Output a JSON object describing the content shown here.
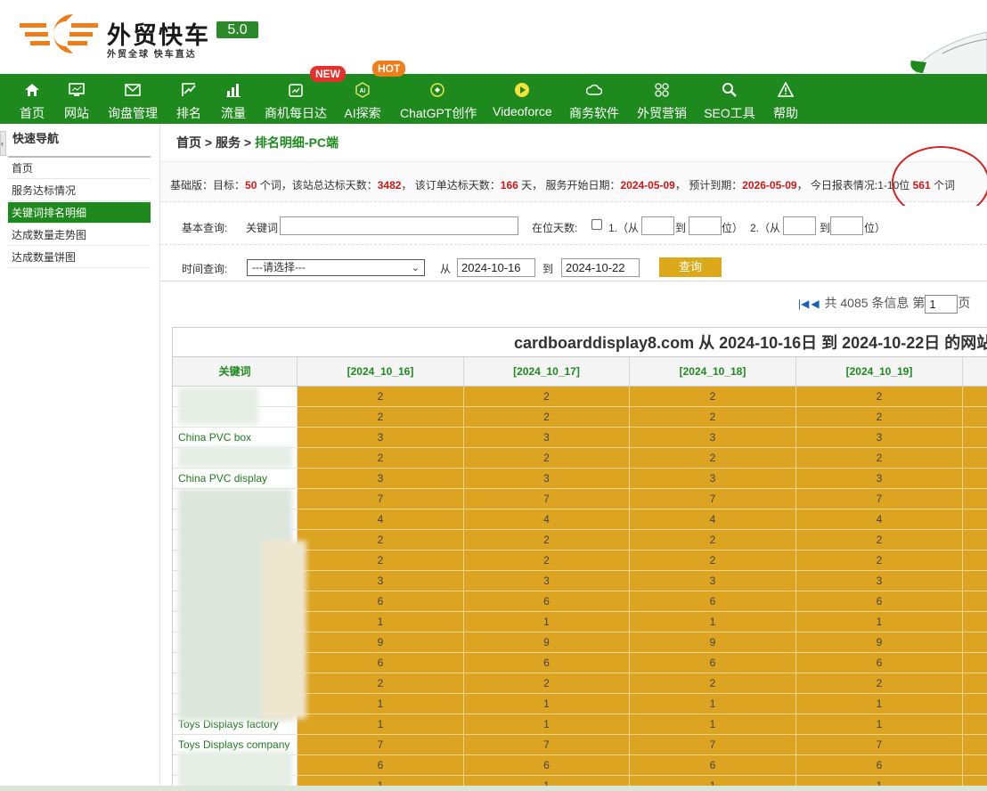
{
  "header": {
    "brand": "外贸快车",
    "slogan": "外贸全球 快车直达",
    "version": "5.0"
  },
  "nav": {
    "items": [
      {
        "label": "首页",
        "icon": "home-icon"
      },
      {
        "label": "网站",
        "icon": "monitor-icon"
      },
      {
        "label": "询盘管理",
        "icon": "mail-icon"
      },
      {
        "label": "排名",
        "icon": "rank-icon"
      },
      {
        "label": "流量",
        "icon": "bar-chart-icon"
      },
      {
        "label": "商机每日达",
        "icon": "calendar-icon"
      },
      {
        "label": "AI探索",
        "icon": "ai-icon"
      },
      {
        "label": "ChatGPT创作",
        "icon": "chatgpt-icon"
      },
      {
        "label": "Videoforce",
        "icon": "video-icon"
      },
      {
        "label": "商务软件",
        "icon": "cloud-icon"
      },
      {
        "label": "外贸营销",
        "icon": "grid-icon"
      },
      {
        "label": "SEO工具",
        "icon": "search-icon"
      },
      {
        "label": "帮助",
        "icon": "warning-icon"
      }
    ],
    "badge_new": "NEW",
    "badge_hot": "HOT"
  },
  "sidebar": {
    "title": "快速导航",
    "items": [
      {
        "label": "首页"
      },
      {
        "label": "服务达标情况"
      },
      {
        "label": "关键词排名明细"
      },
      {
        "label": "达成数量走势图"
      },
      {
        "label": "达成数量饼图"
      }
    ],
    "active_index": 2
  },
  "breadcrumb": {
    "home": "首页",
    "sep1": " > ",
    "service": "服务",
    "sep2": " > ",
    "current": "排名明细-PC端"
  },
  "info": {
    "t1": "基础版：目标：",
    "target": "50",
    "t2": " 个词，该站总达标天数：",
    "total_days": "3482",
    "t3": "，  该订单达标天数：",
    "order_days": "166",
    "t4": " 天，  服务开始日期：",
    "start_date": "2024-05-09",
    "t5": "，  预计到期：",
    "end_date": "2026-05-09",
    "t6": "，     今日报表情况:1-10位 ",
    "today_count": "561",
    "t7": " 个词"
  },
  "query": {
    "basic_label": "基本查询:",
    "keyword_label": "关键词",
    "keyword_value": "",
    "days_label": "在位天数:",
    "opt1_label": "1.（从",
    "to1": "到",
    "pos1": "位）",
    "opt2_label": "2.（从",
    "to2": "到",
    "pos2": "位）",
    "time_label": "时间查询:",
    "select_value": "---请选择---",
    "from_label": "从",
    "from_date": "2024-10-16",
    "to_label": "到",
    "to_date": "2024-10-22",
    "search_button": "查询"
  },
  "pager": {
    "total_text": "共 4085 条信息 第",
    "page": "1",
    "page_suffix": "页"
  },
  "table": {
    "title": "cardboarddisplay8.com 从 2024-10-16日 到 2024-10-22日 的网站",
    "headers": [
      "关键词",
      "[2024_10_16]",
      "[2024_10_17]",
      "[2024_10_18]",
      "[2024_10_19]"
    ],
    "rows": [
      {
        "kw": "",
        "v": [
          "2",
          "2",
          "2",
          "2"
        ]
      },
      {
        "kw": "",
        "v": [
          "2",
          "2",
          "2",
          "2"
        ]
      },
      {
        "kw": "China PVC box",
        "v": [
          "3",
          "3",
          "3",
          "3"
        ]
      },
      {
        "kw": "",
        "v": [
          "2",
          "2",
          "2",
          "2"
        ]
      },
      {
        "kw": "China PVC display",
        "v": [
          "3",
          "3",
          "3",
          "3"
        ]
      },
      {
        "kw": "",
        "v": [
          "7",
          "7",
          "7",
          "7"
        ]
      },
      {
        "kw": "",
        "v": [
          "4",
          "4",
          "4",
          "4"
        ]
      },
      {
        "kw": "",
        "v": [
          "2",
          "2",
          "2",
          "2"
        ]
      },
      {
        "kw": "",
        "v": [
          "2",
          "2",
          "2",
          "2"
        ]
      },
      {
        "kw": "",
        "v": [
          "3",
          "3",
          "3",
          "3"
        ]
      },
      {
        "kw": "",
        "v": [
          "6",
          "6",
          "6",
          "6"
        ]
      },
      {
        "kw": "",
        "v": [
          "1",
          "1",
          "1",
          "1"
        ]
      },
      {
        "kw": "",
        "v": [
          "9",
          "9",
          "9",
          "9"
        ]
      },
      {
        "kw": "",
        "v": [
          "6",
          "6",
          "6",
          "6"
        ]
      },
      {
        "kw": "",
        "v": [
          "2",
          "2",
          "2",
          "2"
        ]
      },
      {
        "kw": "",
        "v": [
          "1",
          "1",
          "1",
          "1"
        ]
      },
      {
        "kw": "Toys Displays factory",
        "v": [
          "1",
          "1",
          "1",
          "1"
        ]
      },
      {
        "kw": "Toys Displays company",
        "v": [
          "7",
          "7",
          "7",
          "7"
        ]
      },
      {
        "kw": "",
        "v": [
          "6",
          "6",
          "6",
          "6"
        ]
      },
      {
        "kw": "",
        "v": [
          "1",
          "1",
          "1",
          "1"
        ]
      }
    ]
  },
  "colors": {
    "brand_green": "#1e8a1e",
    "cell_gold": "#dca421",
    "highlight_red": "#d01818",
    "button_gold": "#dba91a"
  }
}
